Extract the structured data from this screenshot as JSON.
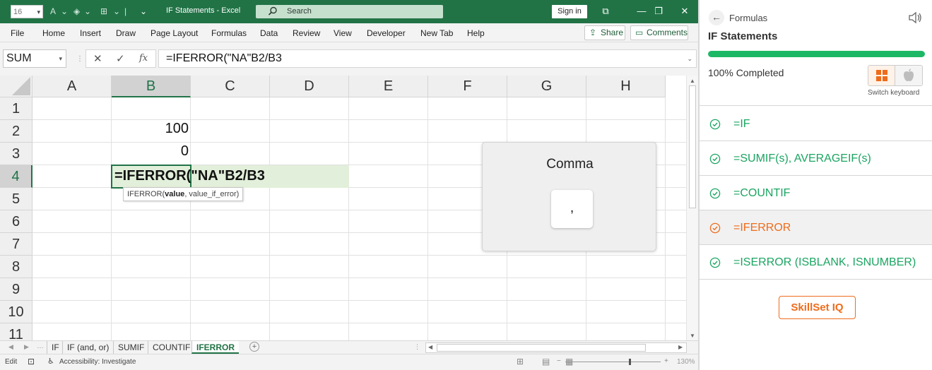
{
  "titlebar": {
    "font_size_value": "16",
    "doc_title": "IF Statements  -  Excel",
    "search_label": "Search",
    "sign_in": "Sign in",
    "accent": "#217346"
  },
  "ribbon": {
    "tabs": [
      "File",
      "Home",
      "Insert",
      "Draw",
      "Page Layout",
      "Formulas",
      "Data",
      "Review",
      "View",
      "Developer",
      "New Tab",
      "Help"
    ],
    "share": "Share",
    "comments": "Comments"
  },
  "formula_bar": {
    "name_box": "SUM",
    "cancel": "✕",
    "enter": "✓",
    "fx": "fx",
    "formula": "=IFERROR(\"NA\"B2/B3"
  },
  "grid": {
    "columns": [
      "A",
      "B",
      "C",
      "D",
      "E",
      "F",
      "G",
      "H"
    ],
    "rows": [
      "1",
      "2",
      "3",
      "4",
      "5",
      "6",
      "7",
      "8",
      "9",
      "10",
      "11"
    ],
    "selected_column": "B",
    "selected_row": "4",
    "cells": {
      "B2": "100",
      "B3": "0",
      "B4": "=IFERROR(\"NA\"B2/B3"
    },
    "tooltip": {
      "fn": "IFERROR(",
      "arg1": "value",
      "rest": ", value_if_error)"
    }
  },
  "popup": {
    "title": "Comma",
    "key": ","
  },
  "sheets": {
    "tabs": [
      "IF",
      "IF (and, or)",
      "SUMIF",
      "COUNTIF",
      "IFERROR"
    ],
    "active": "IFERROR"
  },
  "status": {
    "mode": "Edit",
    "accessibility": "Accessibility: Investigate",
    "zoom": "130%"
  },
  "panel": {
    "breadcrumb": "Formulas",
    "title": "IF Statements",
    "progress_fraction": 1.0,
    "completed_text": "100% Completed",
    "switch_keyboard": "Switch keyboard",
    "lessons": [
      {
        "label": "=IF",
        "state": "done"
      },
      {
        "label": "=SUMIF(s), AVERAGEIF(s)",
        "state": "done"
      },
      {
        "label": "=COUNTIF",
        "state": "done"
      },
      {
        "label": "=IFERROR",
        "state": "current"
      },
      {
        "label": "=ISERROR (ISBLANK, ISNUMBER)",
        "state": "done"
      }
    ],
    "skillset_button": "SkillSet IQ",
    "colors": {
      "done": "#1aa561",
      "current": "#ee6c1c",
      "progress": "#1db865"
    }
  }
}
